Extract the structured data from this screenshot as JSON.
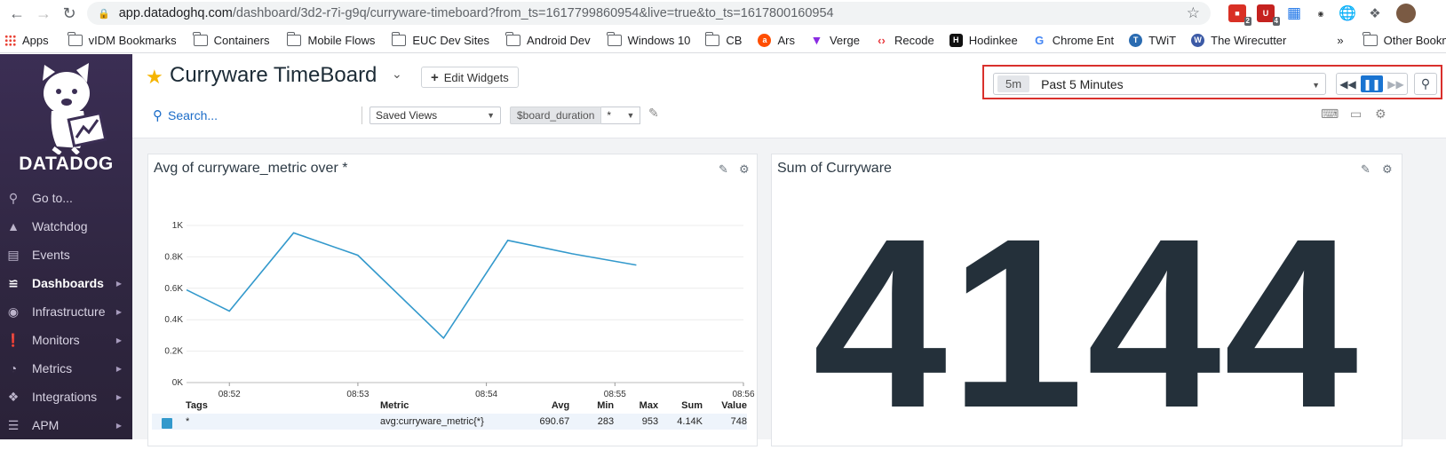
{
  "browser": {
    "url_host": "app.datadoghq.com",
    "url_path": "/dashboard/3d2-r7i-g9q/curryware-timeboard?from_ts=1617799860954&live=true&to_ts=1617800160954",
    "extension_badges": [
      "2",
      "4"
    ],
    "bookmarks": [
      {
        "label": "Apps",
        "icon": "apps-grid-icon"
      },
      {
        "label": "vIDM Bookmarks",
        "icon": "folder-icon"
      },
      {
        "label": "Containers",
        "icon": "folder-icon"
      },
      {
        "label": "Mobile Flows",
        "icon": "folder-icon"
      },
      {
        "label": "EUC Dev Sites",
        "icon": "folder-icon"
      },
      {
        "label": "Android Dev",
        "icon": "folder-icon"
      },
      {
        "label": "Windows 10",
        "icon": "folder-icon"
      },
      {
        "label": "CB",
        "icon": "folder-icon"
      },
      {
        "label": "Ars",
        "icon": "ars-favicon"
      },
      {
        "label": "Verge",
        "icon": "verge-favicon"
      },
      {
        "label": "Recode",
        "icon": "recode-favicon"
      },
      {
        "label": "Hodinkee",
        "icon": "hodinkee-favicon"
      },
      {
        "label": "Chrome Ent",
        "icon": "google-favicon"
      },
      {
        "label": "TWiT",
        "icon": "twit-favicon"
      },
      {
        "label": "The Wirecutter",
        "icon": "wirecutter-favicon"
      }
    ],
    "overflow_label": "»",
    "other_bookmarks": "Other Bookmarks"
  },
  "sidebar": {
    "logo_text": "DATADOG",
    "items": [
      {
        "label": "Go to...",
        "icon": "search-icon",
        "submenu": false
      },
      {
        "label": "Watchdog",
        "icon": "binoculars-icon",
        "submenu": false
      },
      {
        "label": "Events",
        "icon": "events-list-icon",
        "submenu": false
      },
      {
        "label": "Dashboards",
        "icon": "dashboard-chart-icon",
        "submenu": true,
        "active": true
      },
      {
        "label": "Infrastructure",
        "icon": "infrastructure-icon",
        "submenu": true
      },
      {
        "label": "Monitors",
        "icon": "alert-icon",
        "submenu": true
      },
      {
        "label": "Metrics",
        "icon": "gauge-icon",
        "submenu": true
      },
      {
        "label": "Integrations",
        "icon": "puzzle-icon",
        "submenu": true
      },
      {
        "label": "APM",
        "icon": "apm-icon",
        "submenu": true
      }
    ]
  },
  "header": {
    "title": "Curryware TimeBoard",
    "edit_widgets": "Edit Widgets",
    "search_label": "Search...",
    "saved_views": "Saved Views",
    "template_var_name": "$board_duration",
    "template_var_value": "*",
    "time_chip": "5m",
    "time_label": "Past 5 Minutes"
  },
  "widgets": {
    "timeseries": {
      "title": "Avg of curryware_metric over *",
      "legend_headers": [
        "Tags",
        "Metric",
        "Avg",
        "Min",
        "Max",
        "Sum",
        "Value"
      ],
      "legend_rows": [
        {
          "tags": "*",
          "metric": "avg:curryware_metric{*}",
          "avg": "690.67",
          "min": "283",
          "max": "953",
          "sum": "4.14K",
          "value": "748"
        }
      ]
    },
    "query_value": {
      "title": "Sum of Curryware",
      "value": "4144"
    }
  },
  "colors": {
    "series": "#3399cc",
    "sidebar": "#3b2e54",
    "accent": "#1a74d1",
    "highlight_border": "#d9302c"
  },
  "chart_data": {
    "type": "line",
    "title": "Avg of curryware_metric over *",
    "x": [
      "08:51:40",
      "08:52:00",
      "08:52:30",
      "08:53:00",
      "08:53:40",
      "08:54:10",
      "08:54:40",
      "08:55:10"
    ],
    "x_ticks": [
      "08:52",
      "08:53",
      "08:54",
      "08:55",
      "08:56"
    ],
    "y_ticks": [
      "0K",
      "0.2K",
      "0.4K",
      "0.6K",
      "0.8K",
      "1K"
    ],
    "ylim": [
      0,
      1000
    ],
    "series": [
      {
        "name": "avg:curryware_metric{*}",
        "values": [
          590,
          455,
          953,
          810,
          283,
          905,
          820,
          748
        ]
      }
    ],
    "grid": true,
    "xlabel": "",
    "ylabel": ""
  }
}
